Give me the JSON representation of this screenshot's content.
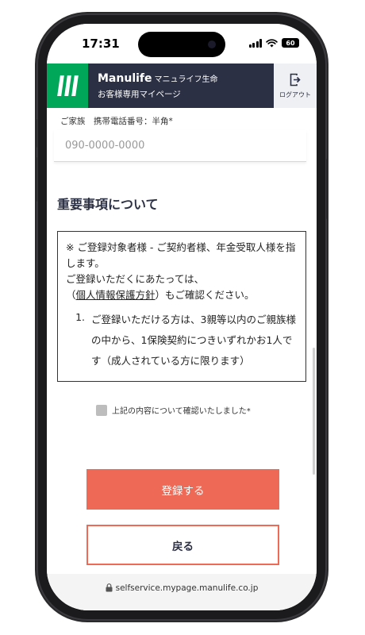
{
  "status_bar": {
    "time": "17:31",
    "battery": "60"
  },
  "header": {
    "brand": "Manulife",
    "brand_sub": "マニュライフ生命",
    "subtitle": "お客様専用マイページ",
    "logout_label": "ログアウト"
  },
  "form": {
    "phone_label": "ご家族　携帯電話番号：半角*",
    "phone_value": "",
    "phone_placeholder": "090-0000-0000"
  },
  "section": {
    "heading": "重要事項について"
  },
  "notice": {
    "para1": "※ ご登録対象者様 - ご契約者様、年金受取人様を指します。",
    "para2": "ご登録いただくにあたっては、",
    "open_paren": "（",
    "link_text": "個人情報保護方針",
    "para3_rest": "）もご確認ください。",
    "items": [
      {
        "num": "1.",
        "text": "ご登録いただける方は、3親等以内のご親族様の中から、1保険契約につきいずれかお1人です（成人されている方に限ります）"
      }
    ]
  },
  "confirm": {
    "label": "上記の内容について確認いたしました*",
    "checked": false
  },
  "buttons": {
    "submit": "登録する",
    "back": "戻る"
  },
  "url_bar": {
    "url": "selfservice.mypage.manulife.co.jp"
  },
  "colors": {
    "header_bg": "#2b3044",
    "brand_green": "#00a758",
    "accent": "#ee6a57"
  }
}
